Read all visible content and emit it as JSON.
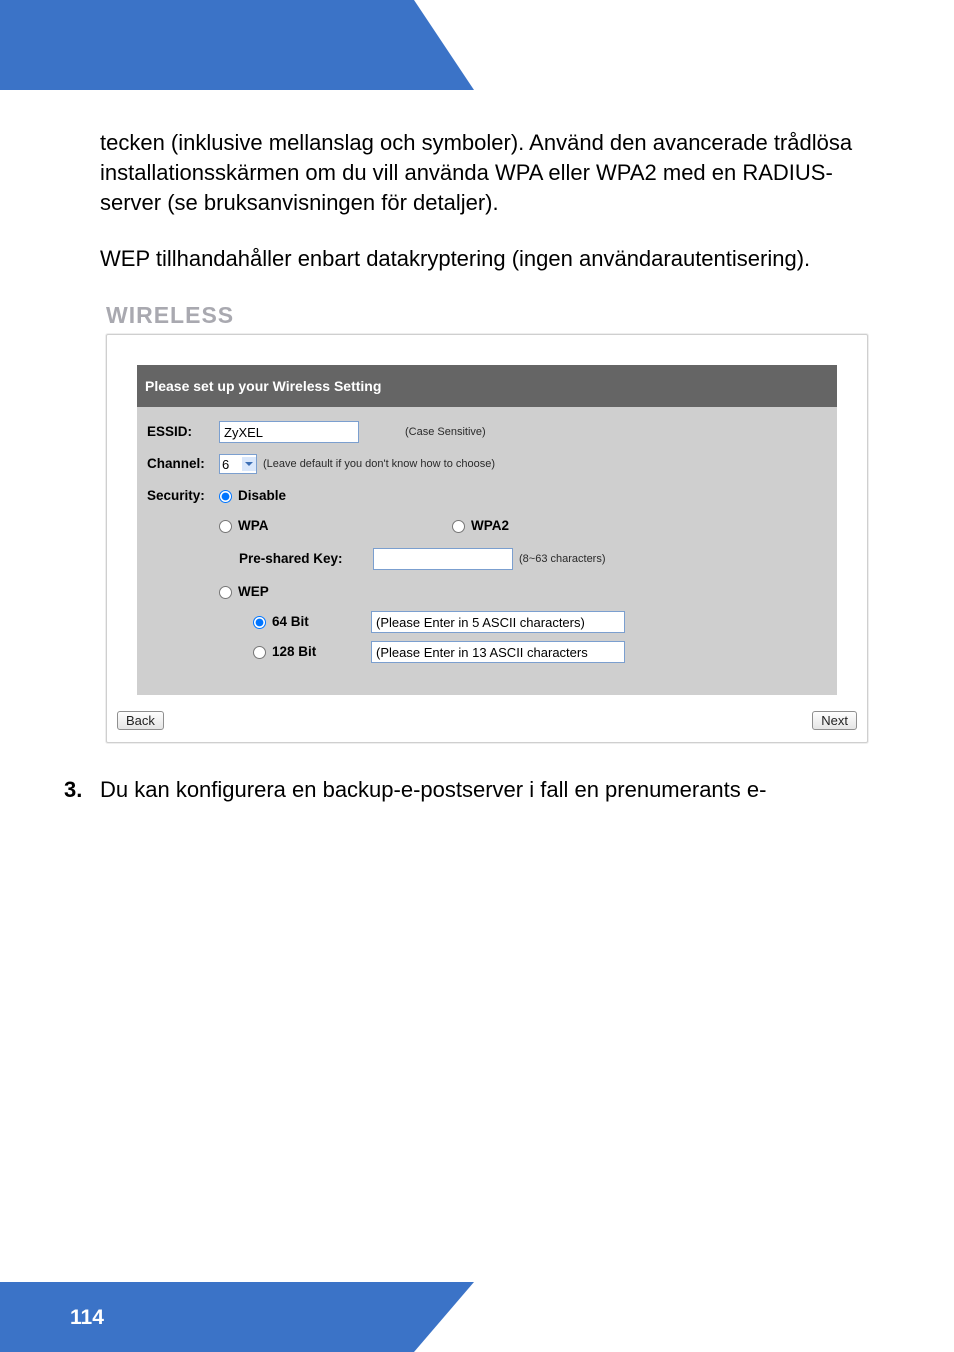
{
  "header": {},
  "text": {
    "para1": "tecken (inklusive mellanslag och symboler). Använd den avancerade trådlösa installationsskärmen om du vill använda WPA eller WPA2 med en RADIUS-server (se bruksanvisningen för detaljer).",
    "para2": "WEP tillhandahåller enbart datakryptering (ingen användarautentisering).",
    "wireless_label": "WIRELESS",
    "step3_num": "3.",
    "step3_text": "Du kan konfigurera en backup-e-postserver i fall en prenumerants e-"
  },
  "panel": {
    "heading": "Please set up your Wireless Setting",
    "essid_label": "ESSID:",
    "essid_value": "ZyXEL",
    "essid_hint": "(Case Sensitive)",
    "channel_label": "Channel:",
    "channel_value": "6",
    "channel_hint": "(Leave default if you don't know how to choose)",
    "security_label": "Security:",
    "disable_label": "Disable",
    "wpa_label": "WPA",
    "wpa2_label": "WPA2",
    "psk_label": "Pre-shared Key:",
    "psk_value": "",
    "psk_hint": "(8~63 characters)",
    "wep_label": "WEP",
    "wep64_label": "64 Bit",
    "wep64_value": "(Please Enter in 5 ASCII characters)",
    "wep128_label": "128 Bit",
    "wep128_value": "(Please Enter in 13 ASCII characters",
    "back": "Back",
    "next": "Next"
  },
  "footer": {
    "page": "114"
  }
}
